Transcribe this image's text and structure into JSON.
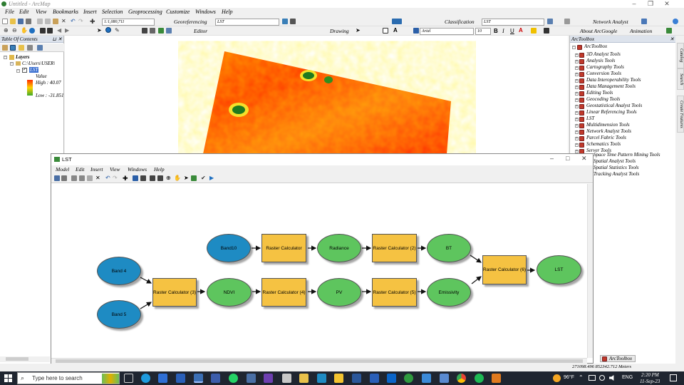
{
  "window": {
    "title": "Untitled - ArcMap"
  },
  "menubar": [
    "File",
    "Edit",
    "View",
    "Bookmarks",
    "Insert",
    "Selection",
    "Geoprocessing",
    "Customize",
    "Windows",
    "Help"
  ],
  "toolbar1": {
    "scale": "1:1,080,711",
    "georef_label": "Georeferencing",
    "georef_layer": "LST",
    "classification_label": "Classification",
    "classification_layer": "LST",
    "network_analyst": "Network Analyst"
  },
  "toolbar2": {
    "editor_label": "Editor",
    "drawing_label": "Drawing",
    "font_name": "Arial",
    "font_size": "10",
    "bold": "B",
    "italic": "I",
    "underline": "U",
    "about_google": "About ArcGoogle",
    "animation": "Animation"
  },
  "toc": {
    "title": "Table Of Contents",
    "layers": "Layers",
    "path": "C:\\Users\\USER\\",
    "layer_name": "LST",
    "value_label": "Value",
    "high": "High : 40.07",
    "low": "Low : -31.851"
  },
  "toolbox": {
    "title": "ArcToolbox",
    "root": "ArcToolbox",
    "items": [
      "3D Analyst Tools",
      "Analysis Tools",
      "Cartography Tools",
      "Conversion Tools",
      "Data Interoperability Tools",
      "Data Management Tools",
      "Editing Tools",
      "Geocoding Tools",
      "Geostatistical Analyst Tools",
      "Linear Referencing Tools",
      "LST",
      "Multidimension Tools",
      "Network Analyst Tools",
      "Parcel Fabric Tools",
      "Schematics Tools",
      "Server Tools"
    ],
    "overflow_items": [
      "Space Time Pattern Mining Tools",
      "Spatial Analyst Tools",
      "Spatial Statistics Tools",
      "Tracking Analyst Tools"
    ],
    "bottom_tab": "ArcToolbox"
  },
  "side_tabs": [
    "Catalog",
    "Search",
    "Create Features"
  ],
  "model": {
    "title": "LST",
    "menu": [
      "Model",
      "Edit",
      "Insert",
      "View",
      "Windows",
      "Help"
    ],
    "nodes": {
      "band10": "Band10",
      "rc1": "Raster Calculator",
      "radiance": "Radiance",
      "rc2": "Raster Calculator (2)",
      "bt": "BT",
      "band4": "Band 4",
      "band5": "Band 5",
      "rc3": "Raster Calculator (3)",
      "ndvi": "NDVI",
      "rc4": "Raster Calculator (4)",
      "pv": "PV",
      "rc5": "Raster Calculator (5)",
      "emissivity": "Emissivity",
      "rc6": "Raster Calculator (6)",
      "lst": "LST"
    }
  },
  "status": {
    "coords": "271098.496  852342.712 Meters"
  },
  "taskbar": {
    "search_placeholder": "Type here to search",
    "weather": "96°F",
    "lang": "ENG",
    "time": "2:20 PM",
    "date": "11-Sep-23"
  }
}
